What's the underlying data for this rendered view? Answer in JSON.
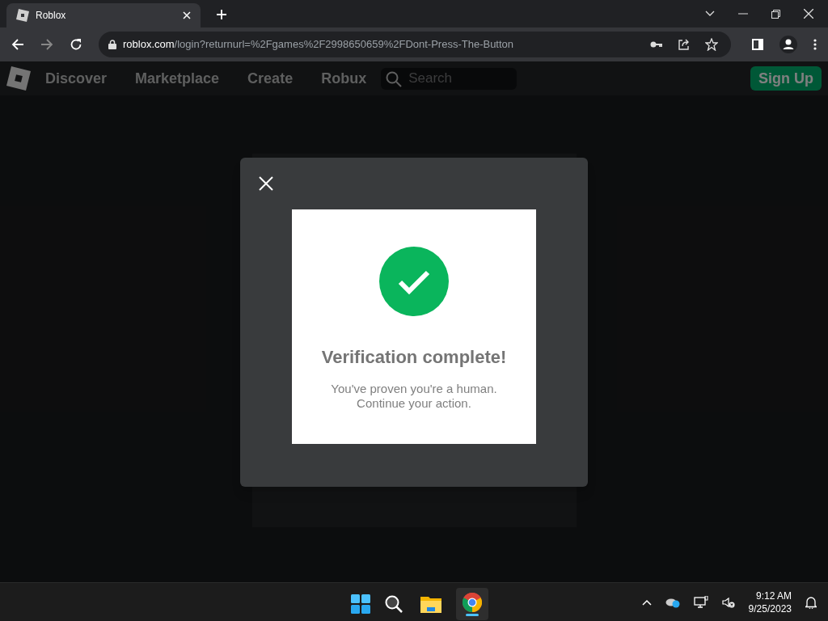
{
  "browser": {
    "tab_title": "Roblox",
    "url_host": "roblox.com",
    "url_path": "/login?returnurl=%2Fgames%2F2998650659%2FDont-Press-The-Button"
  },
  "nav": {
    "items": [
      "Discover",
      "Marketplace",
      "Create",
      "Robux"
    ],
    "search_placeholder": "Search",
    "signup": "Sign Up"
  },
  "modal": {
    "title": "Verification complete!",
    "message": [
      "You've proven you're a human.",
      "Continue your action."
    ]
  },
  "taskbar": {
    "time": "9:12 AM",
    "date": "9/25/2023"
  }
}
